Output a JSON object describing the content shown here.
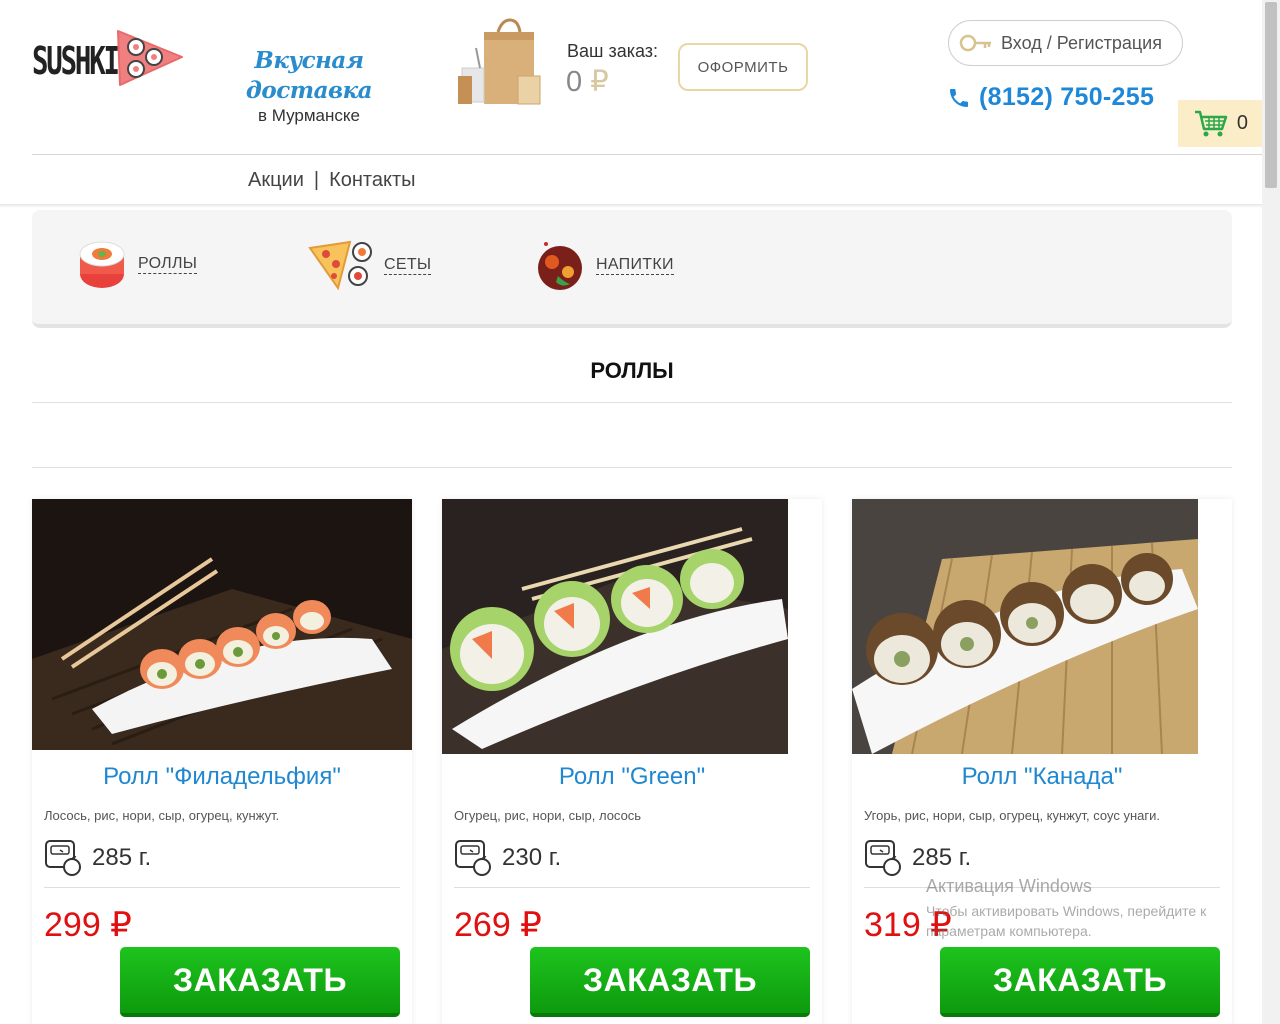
{
  "header": {
    "logo_text": "SUSHKI",
    "tagline_main": "Вкусная доставка",
    "tagline_sub": "в Мурманске",
    "order_label": "Ваш заказ:",
    "order_sum": "0",
    "currency": "₽",
    "checkout_label": "ОФОРМИТЬ",
    "login_label": "Вход / Регистрация",
    "phone": "(8152) 750-255",
    "cart_count": "0"
  },
  "nav": {
    "items": [
      {
        "label": "Акции"
      },
      {
        "label": "Контакты"
      }
    ],
    "separator": "|"
  },
  "categories": [
    {
      "label": "РОЛЛЫ"
    },
    {
      "label": "СЕТЫ"
    },
    {
      "label": "НАПИТКИ"
    }
  ],
  "section_title": "РОЛЛЫ",
  "products": [
    {
      "title": "Ролл \"Филадельфия\"",
      "desc": "Лосось, рис, нори, сыр, огурец, кунжут.",
      "weight": "285 г.",
      "price": "299 ₽",
      "button": "ЗАКАЗАТЬ"
    },
    {
      "title": "Ролл \"Green\"",
      "desc": "Огурец, рис, нори, сыр, лосось",
      "weight": "230 г.",
      "price": "269 ₽",
      "button": "ЗАКАЗАТЬ"
    },
    {
      "title": "Ролл \"Канада\"",
      "desc": "Угорь, рис, нори, сыр, огурец, кунжут, соус унаги.",
      "weight": "285 г.",
      "price": "319 ₽",
      "button": "ЗАКАЗАТЬ"
    }
  ],
  "watermark": {
    "line1": "Активация Windows",
    "line2": "Чтобы активировать Windows, перейдите к параметрам компьютера."
  },
  "colors": {
    "accent_blue": "#1e88d8",
    "price_red": "#e01010",
    "order_green": "#14b014",
    "cart_bg": "#fbedc8"
  },
  "icons": [
    "bag-icon",
    "key-icon",
    "phone-icon",
    "cart-icon",
    "roll-icon",
    "pizza-set-icon",
    "drinks-icon",
    "weight-scale-icon"
  ]
}
